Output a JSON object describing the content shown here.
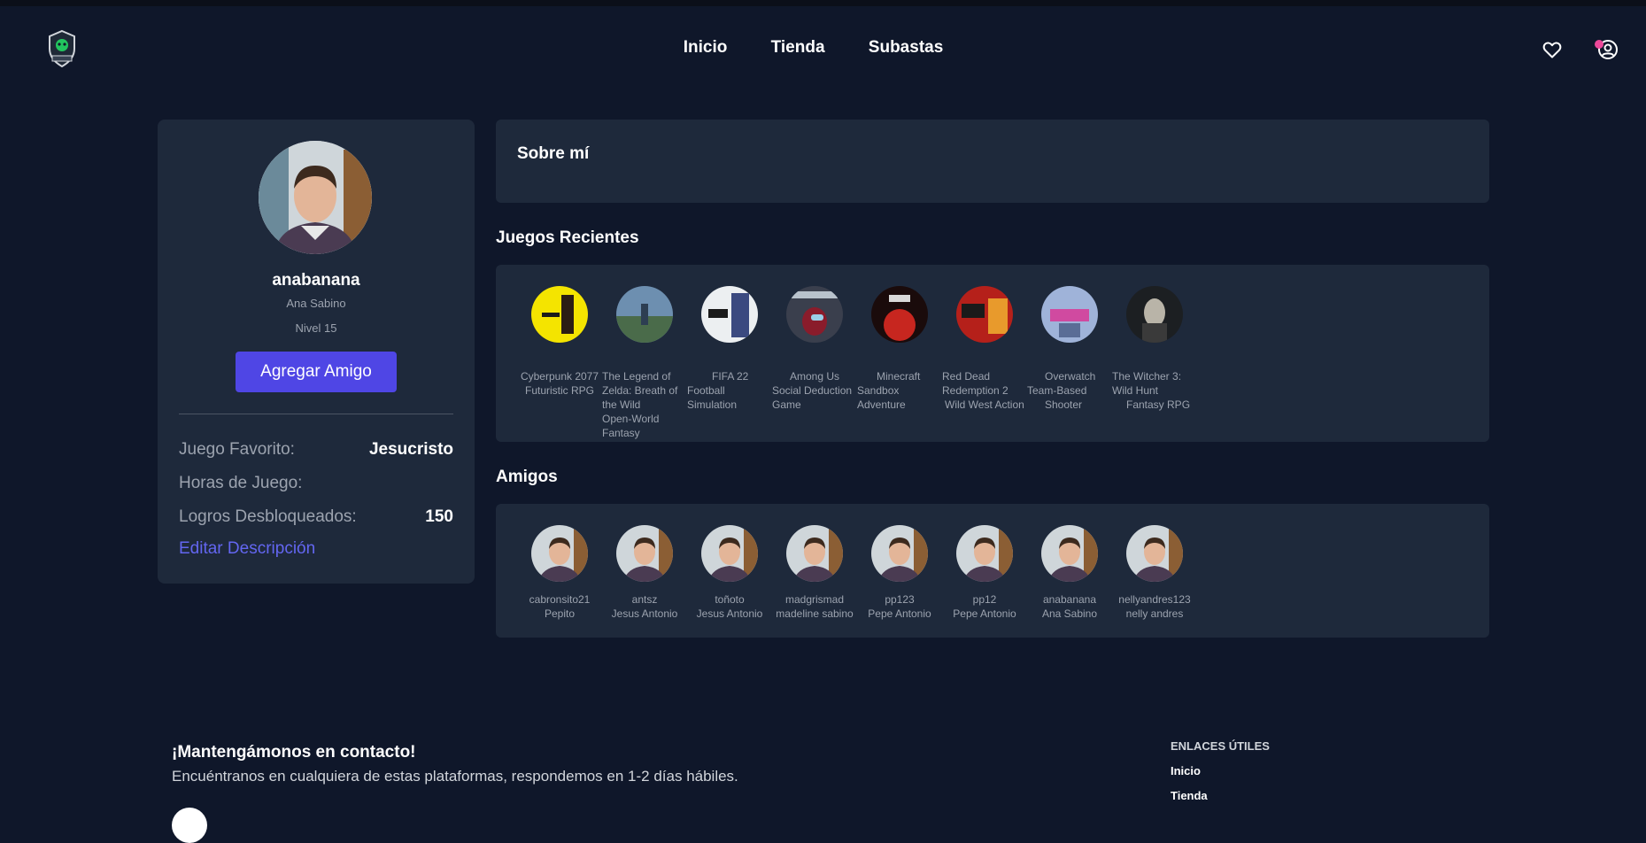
{
  "nav": {
    "links": [
      "Inicio",
      "Tienda",
      "Subastas"
    ],
    "colors": {
      "notification_dot": "#ec4899",
      "accent": "#4f46e5",
      "link": "#6366f1"
    }
  },
  "profile": {
    "username": "anabanana",
    "name": "Ana Sabino",
    "level": "Nivel 15",
    "add_friend_label": "Agregar Amigo",
    "stats": [
      {
        "label": "Juego Favorito:",
        "value": "Jesucristo"
      },
      {
        "label": "Horas de Juego:",
        "value": ""
      },
      {
        "label": "Logros Desbloqueados:",
        "value": "150"
      }
    ],
    "edit_label": "Editar Descripción"
  },
  "about": {
    "title": "Sobre mí"
  },
  "games": {
    "title": "Juegos Recientes",
    "items": [
      {
        "lines": [
          "Cyberpunk 2077",
          "Futuristic RPG"
        ]
      },
      {
        "lines": [
          "The Legend of",
          "Zelda: Breath of",
          "the Wild",
          "Open-World",
          "Fantasy"
        ]
      },
      {
        "lines": [
          "FIFA 22",
          "Football",
          "Simulation"
        ]
      },
      {
        "lines": [
          "Among Us",
          "Social Deduction",
          "Game"
        ]
      },
      {
        "lines": [
          "Minecraft",
          "Sandbox",
          "Adventure"
        ]
      },
      {
        "lines": [
          "Red Dead",
          "Redemption 2",
          "Wild West Action"
        ]
      },
      {
        "lines": [
          "Overwatch",
          "Team-Based",
          "Shooter"
        ]
      },
      {
        "lines": [
          "The Witcher 3:",
          "Wild Hunt",
          "Fantasy RPG"
        ]
      }
    ]
  },
  "friends": {
    "title": "Amigos",
    "items": [
      {
        "username": "cabronsito21",
        "name": "Pepito"
      },
      {
        "username": "antsz",
        "name": "Jesus Antonio"
      },
      {
        "username": "toñoto",
        "name": "Jesus Antonio"
      },
      {
        "username": "madgrismad",
        "name": "madeline sabino"
      },
      {
        "username": "pp123",
        "name": "Pepe Antonio"
      },
      {
        "username": "pp12",
        "name": "Pepe Antonio"
      },
      {
        "username": "anabanana",
        "name": "Ana Sabino"
      },
      {
        "username": "nellyandres123",
        "name": "nelly andres"
      }
    ]
  },
  "footer": {
    "title": "¡Mantengámonos en contacto!",
    "subtitle": "Encuéntranos en cualquiera de estas plataformas, respondemos en 1-2 días hábiles.",
    "links_heading": "ENLACES ÚTILES",
    "links": [
      "Inicio",
      "Tienda"
    ]
  }
}
